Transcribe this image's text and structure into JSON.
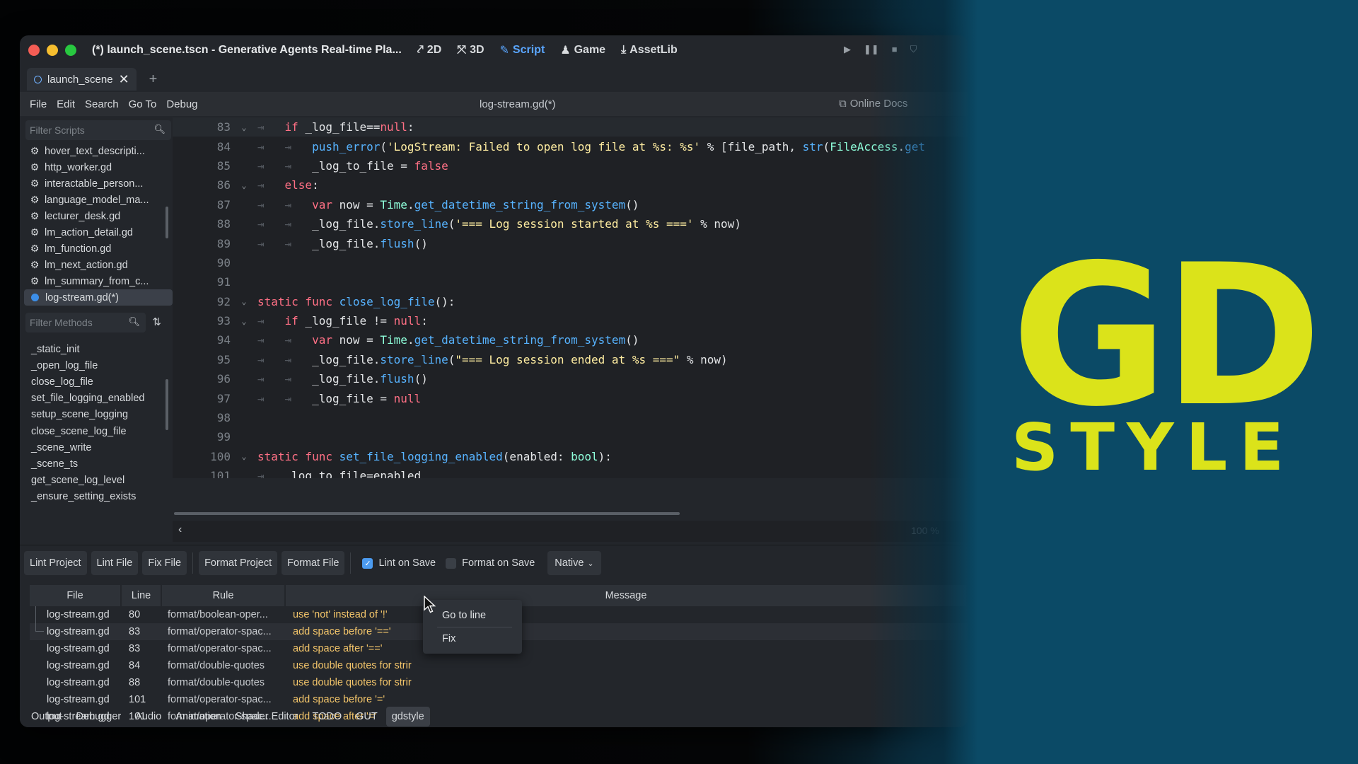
{
  "window": {
    "title": "(*) launch_scene.tscn - Generative Agents Real-time Pla...",
    "main_tabs": [
      {
        "label": "2D",
        "icon": "2d-icon"
      },
      {
        "label": "3D",
        "icon": "3d-icon"
      },
      {
        "label": "Script",
        "icon": "script-icon",
        "active": true
      },
      {
        "label": "Game",
        "icon": "game-icon"
      },
      {
        "label": "AssetLib",
        "icon": "assetlib-icon"
      }
    ]
  },
  "scene_tab": {
    "label": "launch_scene"
  },
  "menu": {
    "items": [
      "File",
      "Edit",
      "Search",
      "Go To",
      "Debug"
    ],
    "script_title": "log-stream.gd(*)",
    "online_docs": "Online Docs"
  },
  "scripts": {
    "filter_placeholder": "Filter Scripts",
    "items": [
      "hover_text_descripti...",
      "http_worker.gd",
      "interactable_person...",
      "language_model_ma...",
      "lecturer_desk.gd",
      "lm_action_detail.gd",
      "lm_function.gd",
      "lm_next_action.gd",
      "lm_summary_from_c...",
      "log-stream.gd(*)"
    ],
    "active_index": 9
  },
  "methods": {
    "filter_placeholder": "Filter Methods",
    "items": [
      "_static_init",
      "_open_log_file",
      "close_log_file",
      "set_file_logging_enabled",
      "setup_scene_logging",
      "close_scene_log_file",
      "_scene_write",
      "_scene_ts",
      "get_scene_log_level",
      "_ensure_setting_exists"
    ]
  },
  "code": {
    "lines": [
      {
        "n": "83",
        "fold": true,
        "indent": 1,
        "current": true,
        "parts": [
          [
            "kw",
            "if"
          ],
          [
            "txt",
            " _log_file=="
          ],
          [
            "kw",
            "null"
          ],
          [
            "txt",
            ":"
          ]
        ]
      },
      {
        "n": "84",
        "indent": 2,
        "parts": [
          [
            "fn",
            "push_error"
          ],
          [
            "txt",
            "("
          ],
          [
            "str",
            "'LogStream: Failed to open log file at %s: %s'"
          ],
          [
            "txt",
            " % [file_path, "
          ],
          [
            "fn",
            "str"
          ],
          [
            "txt",
            "("
          ],
          [
            "cls",
            "FileAccess"
          ],
          [
            "txt",
            "."
          ],
          [
            "fn",
            "get"
          ]
        ]
      },
      {
        "n": "85",
        "indent": 2,
        "parts": [
          [
            "txt",
            "_log_to_file = "
          ],
          [
            "bool",
            "false"
          ]
        ]
      },
      {
        "n": "86",
        "fold": true,
        "indent": 1,
        "parts": [
          [
            "kw",
            "else"
          ],
          [
            "txt",
            ":"
          ]
        ]
      },
      {
        "n": "87",
        "indent": 2,
        "parts": [
          [
            "kw",
            "var"
          ],
          [
            "txt",
            " now = "
          ],
          [
            "cls",
            "Time"
          ],
          [
            "txt",
            "."
          ],
          [
            "fn",
            "get_datetime_string_from_system"
          ],
          [
            "txt",
            "()"
          ]
        ]
      },
      {
        "n": "88",
        "indent": 2,
        "parts": [
          [
            "txt",
            "_log_file."
          ],
          [
            "fn",
            "store_line"
          ],
          [
            "txt",
            "("
          ],
          [
            "str",
            "'=== Log session started at %s ==='"
          ],
          [
            "txt",
            " % now)"
          ]
        ]
      },
      {
        "n": "89",
        "indent": 2,
        "parts": [
          [
            "txt",
            "_log_file."
          ],
          [
            "fn",
            "flush"
          ],
          [
            "txt",
            "()"
          ]
        ]
      },
      {
        "n": "90",
        "indent": 0,
        "parts": []
      },
      {
        "n": "91",
        "indent": 0,
        "parts": []
      },
      {
        "n": "92",
        "fold": true,
        "indent": 0,
        "parts": [
          [
            "kw",
            "static func"
          ],
          [
            "txt",
            " "
          ],
          [
            "fn",
            "close_log_file"
          ],
          [
            "txt",
            "():"
          ]
        ]
      },
      {
        "n": "93",
        "fold": true,
        "indent": 1,
        "parts": [
          [
            "kw",
            "if"
          ],
          [
            "txt",
            " _log_file != "
          ],
          [
            "kw",
            "null"
          ],
          [
            "txt",
            ":"
          ]
        ]
      },
      {
        "n": "94",
        "indent": 2,
        "parts": [
          [
            "kw",
            "var"
          ],
          [
            "txt",
            " now = "
          ],
          [
            "cls",
            "Time"
          ],
          [
            "txt",
            "."
          ],
          [
            "fn",
            "get_datetime_string_from_system"
          ],
          [
            "txt",
            "()"
          ]
        ]
      },
      {
        "n": "95",
        "indent": 2,
        "parts": [
          [
            "txt",
            "_log_file."
          ],
          [
            "fn",
            "store_line"
          ],
          [
            "txt",
            "("
          ],
          [
            "str",
            "\"=== Log session ended at %s ===\""
          ],
          [
            "txt",
            " % now)"
          ]
        ]
      },
      {
        "n": "96",
        "indent": 2,
        "parts": [
          [
            "txt",
            "_log_file."
          ],
          [
            "fn",
            "flush"
          ],
          [
            "txt",
            "()"
          ]
        ]
      },
      {
        "n": "97",
        "indent": 2,
        "parts": [
          [
            "txt",
            "_log_file = "
          ],
          [
            "kw",
            "null"
          ]
        ]
      },
      {
        "n": "98",
        "indent": 0,
        "parts": []
      },
      {
        "n": "99",
        "indent": 0,
        "parts": []
      },
      {
        "n": "100",
        "fold": true,
        "indent": 0,
        "parts": [
          [
            "kw",
            "static func"
          ],
          [
            "txt",
            " "
          ],
          [
            "fn",
            "set_file_logging_enabled"
          ],
          [
            "txt",
            "(enabled: "
          ],
          [
            "cls",
            "bool"
          ],
          [
            "txt",
            "):"
          ]
        ]
      },
      {
        "n": "101",
        "indent": 1,
        "parts": [
          [
            "txt",
            "_log_to_file=enabled"
          ]
        ]
      }
    ],
    "zoom": "100 %"
  },
  "toolbar": {
    "buttons": [
      "Lint Project",
      "Lint File",
      "Fix File",
      "Format Project",
      "Format File"
    ],
    "lint_on_save": "Lint on Save",
    "format_on_save": "Format on Save",
    "mode": "Native"
  },
  "results": {
    "headers": {
      "file": "File",
      "line": "Line",
      "rule": "Rule",
      "message": "Message"
    },
    "rows": [
      {
        "file": "log-stream.gd",
        "line": "80",
        "rule": "format/boolean-oper...",
        "message": "use 'not' instead of '!'"
      },
      {
        "file": "log-stream.gd",
        "line": "83",
        "rule": "format/operator-spac...",
        "message": "add space before '=='"
      },
      {
        "file": "log-stream.gd",
        "line": "83",
        "rule": "format/operator-spac...",
        "message": "add space after '=='"
      },
      {
        "file": "log-stream.gd",
        "line": "84",
        "rule": "format/double-quotes",
        "message": "use double quotes for strir"
      },
      {
        "file": "log-stream.gd",
        "line": "88",
        "rule": "format/double-quotes",
        "message": "use double quotes for strir"
      },
      {
        "file": "log-stream.gd",
        "line": "101",
        "rule": "format/operator-spac...",
        "message": "add space before '='"
      },
      {
        "file": "log-stream.gd",
        "line": "101",
        "rule": "format/operator-spac...",
        "message": "add space after '='"
      }
    ]
  },
  "context_menu": {
    "items": [
      "Go to line",
      "Fix"
    ]
  },
  "bottom_tabs": {
    "items": [
      "Output",
      "Debugger",
      "Audio",
      "Animation",
      "Shader Editor",
      "TODO",
      "GUT",
      "gdstyle"
    ],
    "active_index": 7
  },
  "logo": {
    "line1": "GD",
    "line2": "STYLE",
    "color": "#dbe31a"
  },
  "colors": {
    "accent": "#5aa6ff",
    "warning_text": "#f3c56a",
    "keyword": "#ff7085",
    "function": "#57b3ff"
  }
}
